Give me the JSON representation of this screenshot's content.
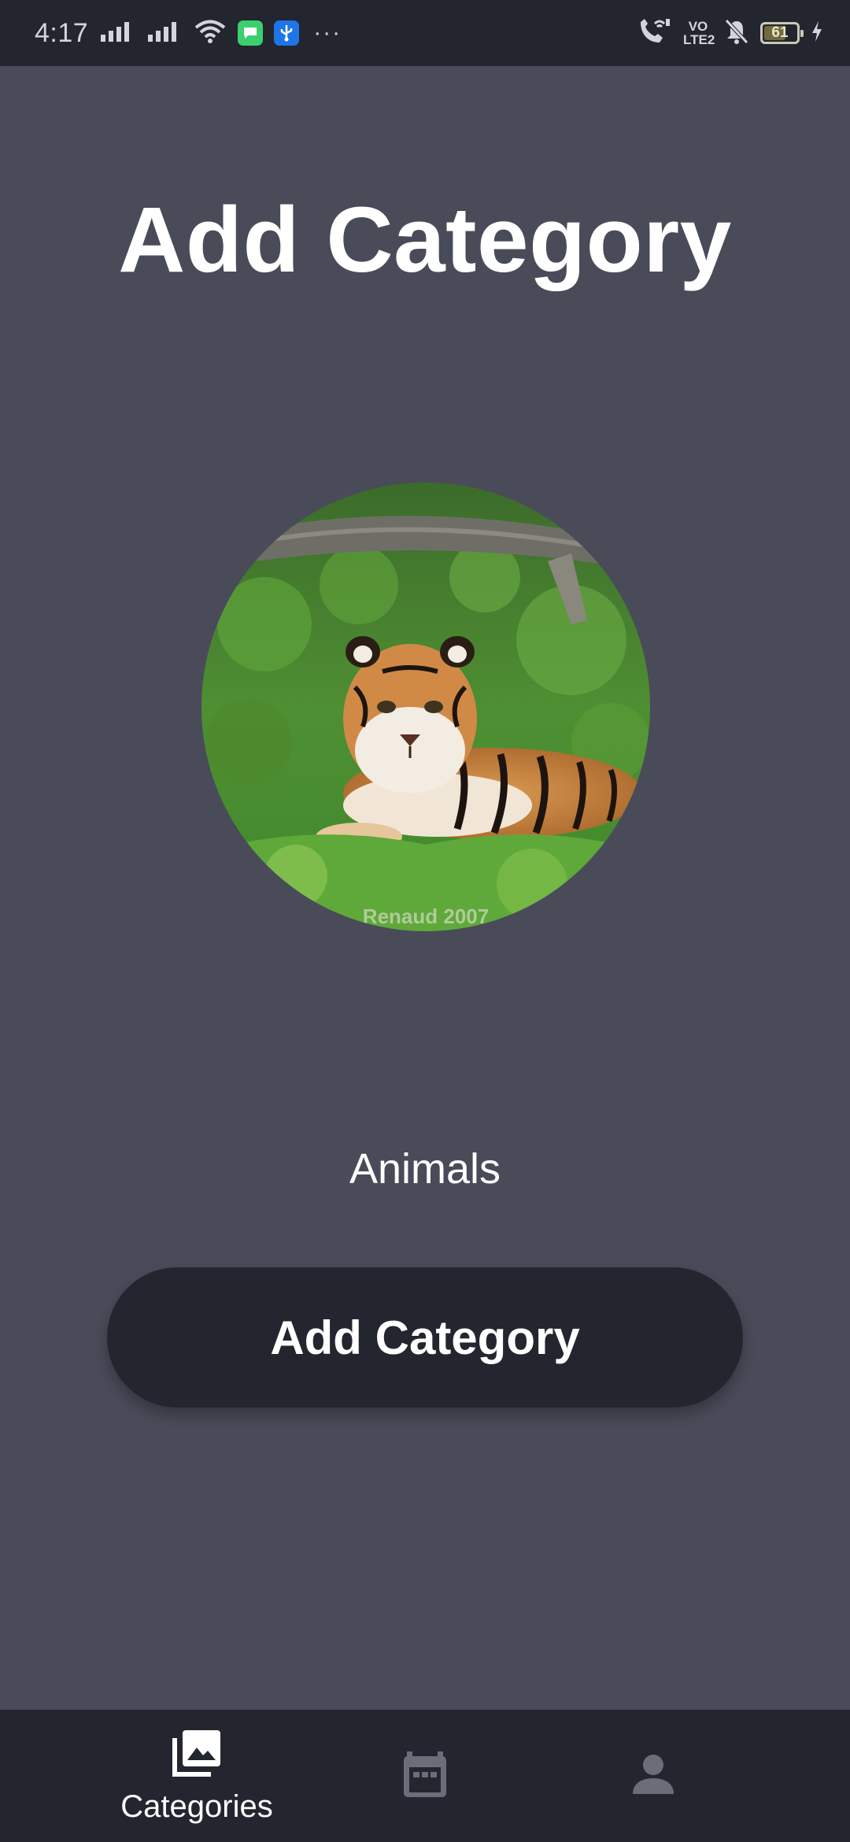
{
  "status_bar": {
    "time": "4:17",
    "battery": "61",
    "lte_top": "VO",
    "lte_bottom": "LTE2",
    "more": "···"
  },
  "page": {
    "title": "Add Category",
    "category_name": "Animals",
    "add_button_label": "Add Category",
    "image_watermark": "Renaud 2007"
  },
  "bottom_nav": {
    "items": [
      {
        "label": "Categories",
        "icon": "photo-library-icon",
        "active": true
      },
      {
        "label": "",
        "icon": "calendar-icon",
        "active": false
      },
      {
        "label": "",
        "icon": "person-icon",
        "active": false
      }
    ]
  },
  "colors": {
    "background": "#494b59",
    "bars": "#23252f",
    "text": "#ffffff",
    "inactive_icon": "#6b6d79"
  }
}
